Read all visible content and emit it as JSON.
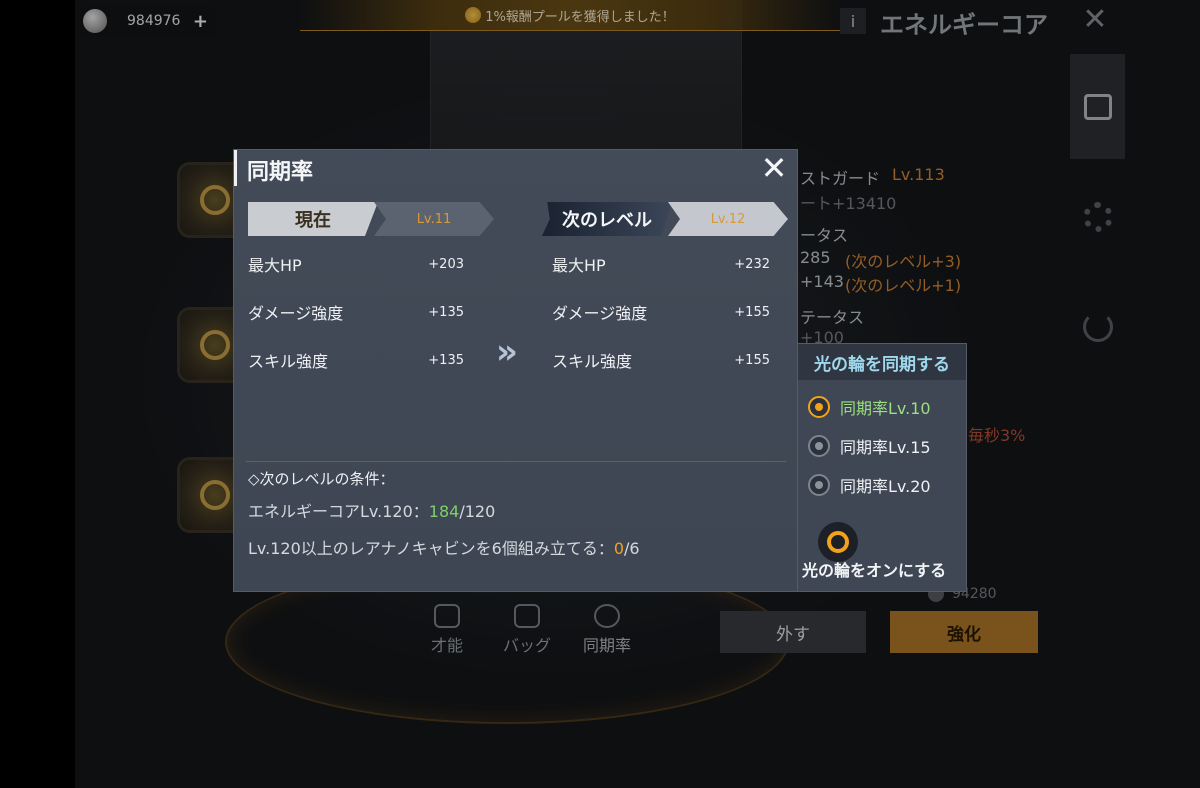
{
  "topbar": {
    "currency_value": "984976",
    "plus_label": "+",
    "banner_text": "1%報酬プールを獲得しました！",
    "info_label": "i",
    "screen_title": "エネルギーコア",
    "close_label": "✕"
  },
  "background_panel": {
    "lines": [
      {
        "text": "ストガード",
        "class": ""
      },
      {
        "text": "Lv.113",
        "class": "orange"
      },
      {
        "text": "ート+13410",
        "class": "dim"
      },
      {
        "text": "ータス",
        "class": ""
      },
      {
        "text": "285",
        "class": ""
      },
      {
        "text": "(次のレベル+3)",
        "class": "orange"
      },
      {
        "text": "+143",
        "class": ""
      },
      {
        "text": "(次のレベル+1)",
        "class": "orange"
      },
      {
        "text": "テータス",
        "class": ""
      },
      {
        "text": "+100",
        "class": "dim"
      },
      {
        "text": "毎秒3%",
        "class": "red"
      }
    ],
    "cost_value": "94280",
    "remove_label": "外す",
    "enhance_label": "強化"
  },
  "bottom_tabs": [
    {
      "label": "才能"
    },
    {
      "label": "バッグ"
    },
    {
      "label": "同期率"
    }
  ],
  "modal": {
    "title": "同期率",
    "close_label": "✕",
    "current": {
      "tag_label": "現在",
      "level": "Lv.11",
      "stats": [
        {
          "name": "最大HP",
          "value": "+203"
        },
        {
          "name": "ダメージ強度",
          "value": "+135"
        },
        {
          "name": "スキル強度",
          "value": "+135"
        }
      ]
    },
    "next": {
      "tag_label": "次のレベル",
      "level": "Lv.12",
      "stats": [
        {
          "name": "最大HP",
          "value": "+232"
        },
        {
          "name": "ダメージ強度",
          "value": "+155"
        },
        {
          "name": "スキル強度",
          "value": "+155"
        }
      ]
    },
    "arrow_glyph": "»",
    "conditions": {
      "title": "◇次のレベルの条件：",
      "line1_prefix": "エネルギーコアLv.120：",
      "line1_have": "184",
      "line1_need": "/120",
      "line2_prefix": "Lv.120以上のレアナノキャビンを6個組み立てる：",
      "line2_have": "0",
      "line2_need": "/6"
    }
  },
  "sync_panel": {
    "title": "光の輪を同期する",
    "options": [
      {
        "label": "同期率Lv.10",
        "selected": true
      },
      {
        "label": "同期率Lv.15",
        "selected": false
      },
      {
        "label": "同期率Lv.20",
        "selected": false
      }
    ],
    "activate_label": "光の輪をオンにする"
  },
  "colors": {
    "accent_orange": "#f3a21b",
    "ok_green": "#7fd06a",
    "panel_title": "#9fd8ec"
  }
}
